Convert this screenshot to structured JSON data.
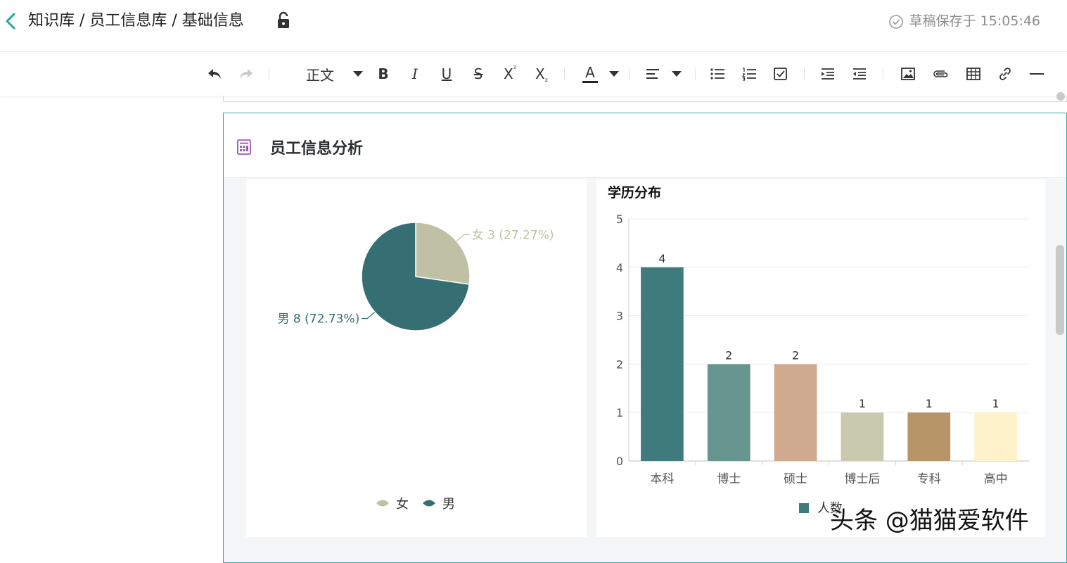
{
  "header": {
    "breadcrumb": "知识库 / 员工信息库 / 基础信息",
    "save_status": "草稿保存于 15:05:46"
  },
  "toolbar": {
    "paragraph_style": "正文",
    "bold": "B",
    "italic": "I",
    "underline": "U",
    "strike": "S",
    "superscript": "X",
    "superscript_mark": "²",
    "subscript": "X",
    "subscript_mark": "₂",
    "font_color": "A",
    "accent_color": "#3aa9a1"
  },
  "card": {
    "title": "员工信息分析"
  },
  "chart_data": [
    {
      "type": "pie",
      "title": "",
      "slices": [
        {
          "name": "女",
          "value": 3,
          "percent": "27.27%",
          "label": "女 3 (27.27%)",
          "color": "#bfc0a4"
        },
        {
          "name": "男",
          "value": 8,
          "percent": "72.73%",
          "label": "男 8 (72.73%)",
          "color": "#356e73"
        }
      ],
      "legend": [
        "女",
        "男"
      ],
      "legend_position": "bottom"
    },
    {
      "type": "bar",
      "title": "学历分布",
      "categories": [
        "本科",
        "博士",
        "硕士",
        "博士后",
        "专科",
        "高中"
      ],
      "series": [
        {
          "name": "人数",
          "values": [
            4,
            2,
            2,
            1,
            1,
            1
          ]
        }
      ],
      "colors": [
        "#3f7a7d",
        "#66968f",
        "#d0aa8e",
        "#c9c9ad",
        "#b79569",
        "#fdf2c9"
      ],
      "yticks": [
        0,
        1,
        2,
        3,
        4,
        5
      ],
      "ylim": [
        0,
        5
      ],
      "grid": true,
      "legend_position": "bottom"
    }
  ],
  "watermark": "头条 @猫猫爱软件"
}
